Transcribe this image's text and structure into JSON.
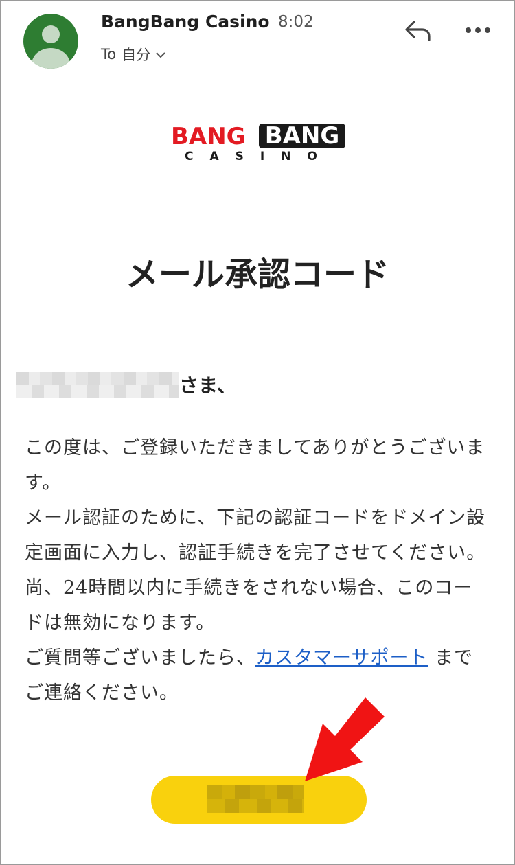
{
  "email_header": {
    "sender": "BangBang Casino",
    "time": "8:02",
    "recipient_prefix": "To",
    "recipient": "自分",
    "avatar_color": "#2e7d32"
  },
  "logo": {
    "word1": "BANG",
    "word2": "BANG",
    "subtitle": "CASINO",
    "red": "#e31b23",
    "black": "#1a1a1a"
  },
  "email_body": {
    "title": "メール承認コード",
    "salutation": "さま、",
    "paragraphs": [
      "この度は、ご登録いただきましてありがとうございます。",
      "メール認証のために、下記の認証コードをドメイン設定画面に入力し、認証手続きを完了させてください。",
      "尚、24時間以内に手続きをされない場合、このコードは無効になります。"
    ],
    "support_prefix": "ご質問等ございましたら、",
    "support_link": "カスタマーサポート",
    "support_suffix": " までご連絡ください。",
    "link_color": "#1d5fc7"
  },
  "code_button": {
    "color": "#f9d10d"
  },
  "annotation": {
    "arrow_color": "#f01414"
  }
}
